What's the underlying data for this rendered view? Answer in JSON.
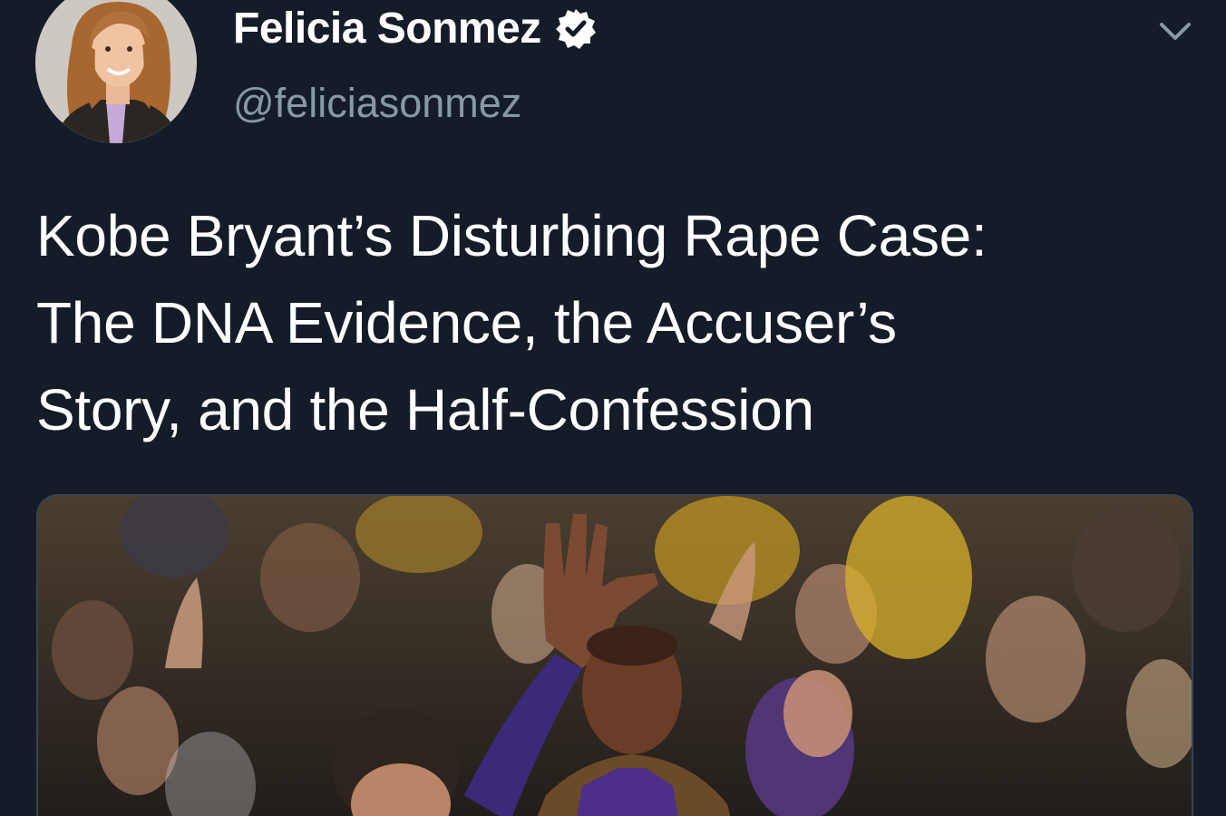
{
  "author": {
    "display_name": "Felicia Sonmez",
    "handle": "@feliciasonmez",
    "verified": true,
    "avatar_icon": "profile-photo"
  },
  "tweet": {
    "text_lines": [
      "Kobe Bryant’s Disturbing Rape Case:",
      "The DNA Evidence, the Accuser’s",
      "Story, and the Half-Confession"
    ]
  },
  "icons": {
    "verified": "verified-badge-icon",
    "menu": "chevron-down-icon"
  },
  "colors": {
    "background": "#151c29",
    "text": "#ffffff",
    "secondary_text": "#8899a6",
    "border": "#38444d"
  }
}
